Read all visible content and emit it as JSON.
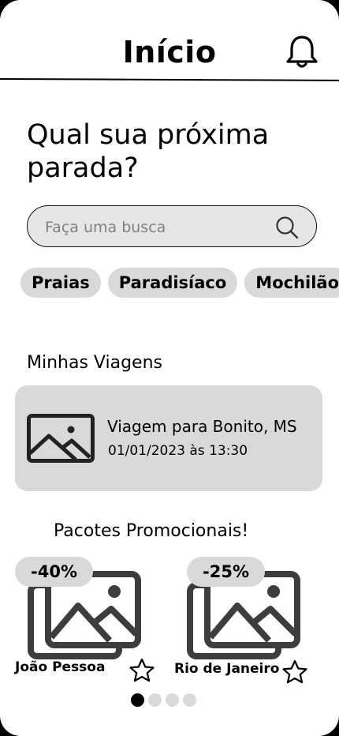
{
  "header": {
    "title": "Início",
    "bell_icon": "bell-icon"
  },
  "hero": {
    "headline": "Qual sua próxima parada?"
  },
  "search": {
    "placeholder": "Faça uma busca",
    "value": "",
    "icon": "search-icon"
  },
  "categories": [
    "Praias",
    "Paradisíaco",
    "Mochilão"
  ],
  "my_trips": {
    "label": "Minhas Viagens",
    "items": [
      {
        "title": "Viagem para Bonito, MS",
        "datetime": "01/01/2023 às 13:30",
        "icon": "image-placeholder-icon"
      }
    ]
  },
  "promos": {
    "label": "Pacotes Promocionais!",
    "items": [
      {
        "discount": "-40%",
        "name": "João Pessoa",
        "icon": "image-placeholder-icon"
      },
      {
        "discount": "-25%",
        "name": "Rio de Janeiro",
        "icon": "image-placeholder-icon"
      }
    ]
  },
  "pagination": {
    "pages": 4,
    "active": 1
  },
  "colors": {
    "card_bg": "#d9d9d9",
    "search_bg": "#e6e6e6",
    "icon_stroke": "#3d3d3d"
  }
}
